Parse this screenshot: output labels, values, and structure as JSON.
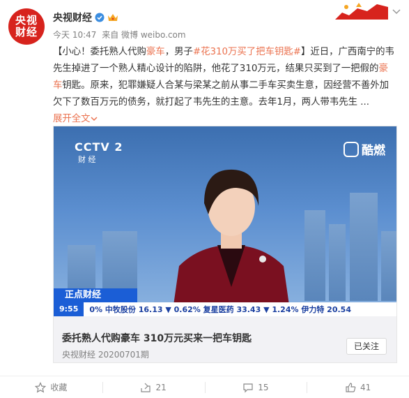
{
  "header": {
    "avatar_line1": "央视",
    "avatar_line2": "财经",
    "author": "央视财经",
    "time": "今天 10:47",
    "source": "来自 微博 weibo.com"
  },
  "post": {
    "seg1": "【小心！委托熟人代购",
    "seg2": "豪车",
    "seg3": "，男子",
    "hashtag": "#花310万买了把车钥匙#",
    "seg4": "】近日，广西南宁的韦先生掉进了一个熟人精心设计的陷阱，他花了310万元，结果只买到了一把假的",
    "seg5": "豪车",
    "seg6": "钥匙。原来，犯罪嫌疑人合某与梁某之前从事二手车买卖生意，因经营不善外加欠下了数百万元的债务，就打起了韦先生的主意。去年1月，两人带韦先生 ...",
    "expand": "展开全文",
    "expand_icon": "chevron-down-icon"
  },
  "video": {
    "channel_logo": "CCTV 2",
    "channel_sub": "财 经",
    "platform": "酷燃",
    "program": "正点财经",
    "ticker_time": "9:55",
    "ticker_text": "0%    中牧股份  16.13  ▼ 0.62%    复星医药  33.43  ▼ 1.24%    伊力特  20.54"
  },
  "card": {
    "title": "委托熟人代购豪车 310万元买来一把车钥匙",
    "sub": "央视财经 20200701期",
    "follow": "已关注"
  },
  "actions": {
    "favorite": "收藏",
    "repost": "21",
    "comment": "15",
    "like": "41"
  },
  "colors": {
    "accent": "#eb7350",
    "brand_red": "#d7231d",
    "ticker_blue": "#1b5ed6"
  }
}
